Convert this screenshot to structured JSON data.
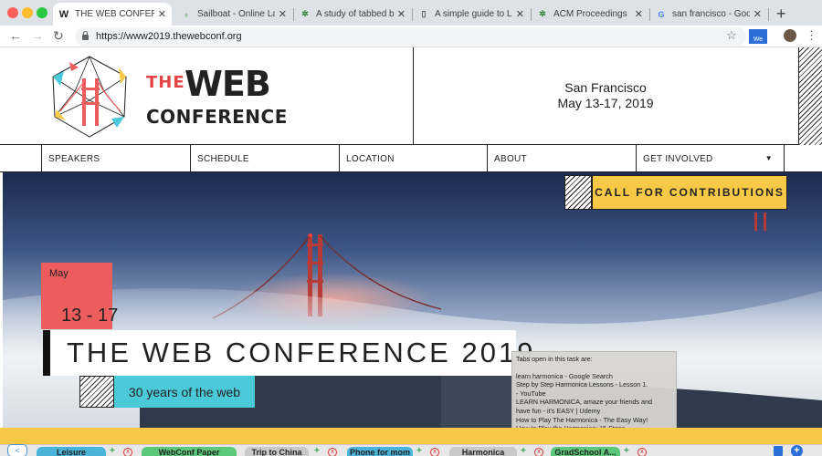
{
  "browser": {
    "tabs": [
      {
        "title": "THE WEB CONFERENC",
        "icon": "W",
        "active": true
      },
      {
        "title": "Sailboat - Online LaT",
        "icon": "leaf",
        "active": false
      },
      {
        "title": "A study of tabbed br",
        "icon": "puzzle",
        "active": false
      },
      {
        "title": "A simple guide to LaT",
        "icon": "document",
        "active": false
      },
      {
        "title": "ACM Proceedings",
        "icon": "puzzle",
        "active": false
      },
      {
        "title": "san francisco - Goog",
        "icon": "G",
        "active": false
      }
    ],
    "new_tab": "+",
    "url": "https://www2019.thewebconf.org",
    "ext_label": "We",
    "menu": "⋮"
  },
  "header": {
    "logo_the": "THE",
    "logo_web": "WEB",
    "logo_conference": "CONFERENCE",
    "city": "San Francisco",
    "dates": "May 13-17, 2019"
  },
  "nav": {
    "items": [
      "SPEAKERS",
      "SCHEDULE",
      "LOCATION",
      "ABOUT",
      "GET INVOLVED"
    ],
    "caret": "▼"
  },
  "hero": {
    "cta": "CALL FOR CONTRIBUTIONS",
    "month": "May",
    "day_range": "13 - 17",
    "title": "THE WEB CONFERENCE 2019",
    "subtitle": "30 years of the web"
  },
  "tooltip": {
    "heading": "Tabs open in this task are:",
    "lines": [
      "learn harmonica - Google Search",
      "Step by Step Harmonica Lessons - Lesson 1.",
      "- YouTube",
      "LEARN HARMONICA, amaze your friends and",
      "have fun - it's EASY | Udemy",
      "How to Play The Harmonica - The Easy Way!",
      "How to Play the Harmonica: 15 Steps"
    ]
  },
  "taskbar": {
    "prev": "<",
    "tasks": [
      {
        "name": "Leisure",
        "color": "#4ab3d9"
      },
      {
        "name": "WebConf Paper",
        "color": "#5cc87a"
      },
      {
        "name": "Trip to China",
        "color": "#c9c9c9"
      },
      {
        "name": "Phone for mom",
        "color": "#4ab3d9"
      },
      {
        "name": "Harmonica",
        "color": "#c9c9c9"
      },
      {
        "name": "GradSchool A...",
        "color": "#5cc87a"
      }
    ],
    "plus": "+",
    "close": "x",
    "add": "+"
  },
  "colors": {
    "accent_red": "#ee5d5d",
    "accent_yellow": "#f7c947",
    "accent_cyan": "#4cc9d9"
  }
}
